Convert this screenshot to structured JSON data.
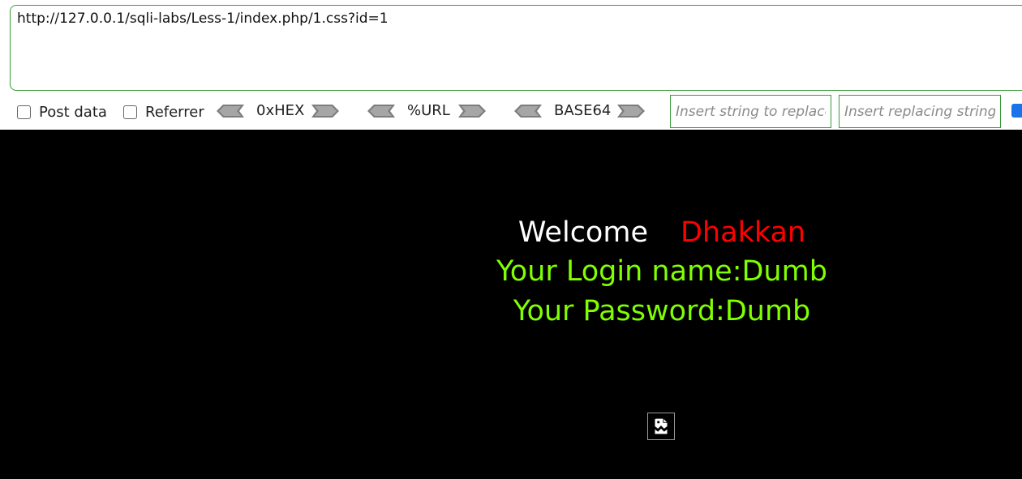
{
  "url_bar": {
    "value": "http://127.0.0.1/sqli-labs/Less-1/index.php/1.css?id=1"
  },
  "options": {
    "post_data_label": "Post data",
    "referrer_label": "Referrer",
    "post_data_checked": false,
    "referrer_checked": false
  },
  "encoders": [
    {
      "label": "0xHEX"
    },
    {
      "label": "%URL"
    },
    {
      "label": "BASE64"
    }
  ],
  "replace": {
    "find_placeholder": "Insert string to replace",
    "replace_placeholder": "Insert replacing string"
  },
  "colors": {
    "accent_border": "#3a9a3a",
    "page_background": "#000000",
    "welcome": "#ffffff",
    "username": "#ff0000",
    "credentials": "#7fff00"
  },
  "page": {
    "welcome": "Welcome",
    "username": "Dhakkan",
    "login_line": "Your Login name:Dumb",
    "password_line": "Your Password:Dumb",
    "image_icon": "broken-image-icon"
  }
}
